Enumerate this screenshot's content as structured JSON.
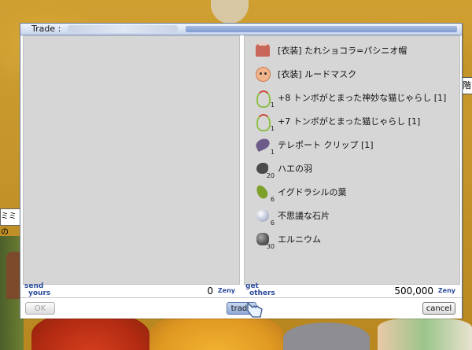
{
  "window": {
    "title": "Trade :"
  },
  "my_panel": {
    "label_line1": "send",
    "label_line2": "yours",
    "zeny_amount": "0",
    "zeny_unit": "Zeny",
    "items": []
  },
  "other_panel": {
    "label_line1": "get",
    "label_line2": "others",
    "zeny_amount": "500,000",
    "zeny_unit": "Zeny",
    "items": [
      {
        "name": "[衣装] たれショコラ=パシニオ帽",
        "qty": "",
        "icon": "cat-hat-icon"
      },
      {
        "name": "[衣装] ルードマスク",
        "qty": "",
        "icon": "mask-icon"
      },
      {
        "name": "+8 トンボがとまった神妙な猫じゃらし [1]",
        "qty": "1",
        "icon": "wand-icon"
      },
      {
        "name": "+7 トンボがとまった猫じゃらし [1]",
        "qty": "1",
        "icon": "wand-icon"
      },
      {
        "name": "テレポート クリップ [1]",
        "qty": "1",
        "icon": "clip-icon"
      },
      {
        "name": "ハエの羽",
        "qty": "20",
        "icon": "fly-wing-icon"
      },
      {
        "name": "イグドラシルの葉",
        "qty": "6",
        "icon": "leaf-icon"
      },
      {
        "name": "不思議な石片",
        "qty": "6",
        "icon": "stone-icon"
      },
      {
        "name": "エルニウム",
        "qty": "30",
        "icon": "ore-icon"
      }
    ]
  },
  "buttons": {
    "ok": "OK",
    "trade": "trade",
    "cancel": "cancel"
  },
  "background": {
    "sign_text": "階",
    "name_tag": "ミミの"
  }
}
